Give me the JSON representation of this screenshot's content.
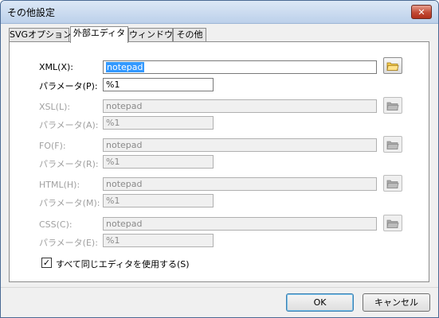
{
  "window": {
    "title": "その他設定",
    "close_label": "✕"
  },
  "tabs": [
    {
      "label": "SVGオプション"
    },
    {
      "label": "外部エディタ"
    },
    {
      "label": "ウィンドウ"
    },
    {
      "label": "その他"
    }
  ],
  "editors": [
    {
      "label": "XML(X):",
      "value": "notepad",
      "param_label": "パラメータ(P):",
      "param_value": "%1",
      "enabled": true
    },
    {
      "label": "XSL(L):",
      "value": "notepad",
      "param_label": "パラメータ(A):",
      "param_value": "%1",
      "enabled": false
    },
    {
      "label": "FO(F):",
      "value": "notepad",
      "param_label": "パラメータ(R):",
      "param_value": "%1",
      "enabled": false
    },
    {
      "label": "HTML(H):",
      "value": "notepad",
      "param_label": "パラメータ(M):",
      "param_value": "%1",
      "enabled": false
    },
    {
      "label": "CSS(C):",
      "value": "notepad",
      "param_label": "パラメータ(E):",
      "param_value": "%1",
      "enabled": false
    }
  ],
  "same_editor": {
    "label": "すべて同じエディタを使用する(S)",
    "checked": true,
    "mark": "✓"
  },
  "buttons": {
    "ok": "OK",
    "cancel": "キャンセル"
  },
  "icons": {
    "browse": "folder-icon"
  }
}
